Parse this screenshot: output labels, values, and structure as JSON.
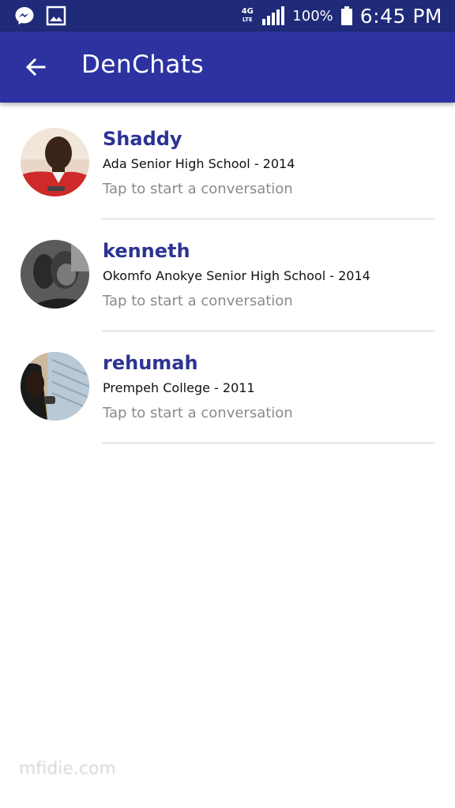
{
  "status_bar": {
    "network_type_top": "4G",
    "network_type_bottom": "LTE",
    "battery_percent": "100%",
    "time": "6:45 PM",
    "left_icons": [
      "messenger-icon",
      "gallery-icon"
    ]
  },
  "app_bar": {
    "title": "DenChats",
    "background": "#2c33a0",
    "back_icon": "arrow-left-icon"
  },
  "chats": [
    {
      "name": "Shaddy",
      "school": "Ada Senior High School - 2014",
      "hint": "Tap to start a conversation"
    },
    {
      "name": "kenneth",
      "school": "Okomfo Anokye Senior High School - 2014",
      "hint": "Tap to start a conversation"
    },
    {
      "name": "rehumah",
      "school": "Prempeh College - 2011",
      "hint": "Tap to start a conversation"
    }
  ],
  "watermark": "mfidie.com",
  "colors": {
    "status_bar": "#1f2a78",
    "app_bar": "#2c33a0",
    "name": "#2c3394",
    "hint": "#8a8a8a"
  }
}
